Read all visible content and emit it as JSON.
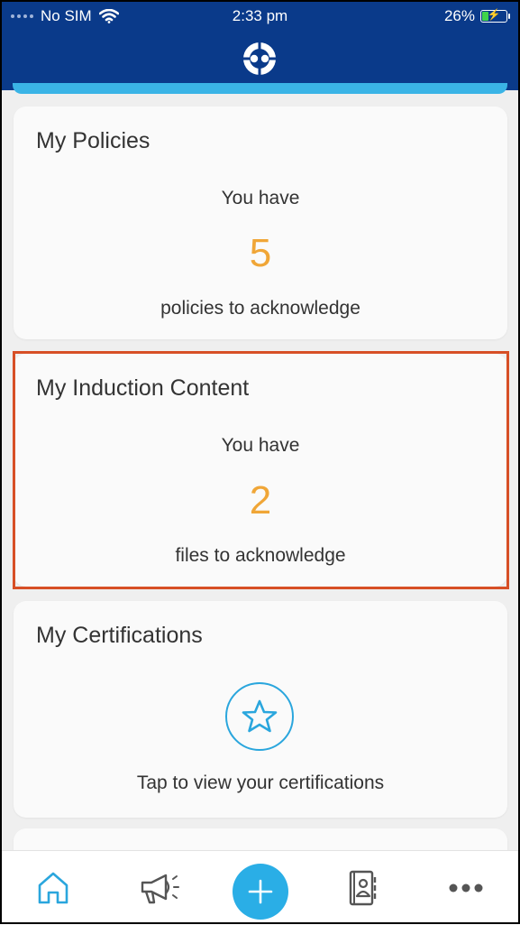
{
  "status_bar": {
    "carrier": "No SIM",
    "time": "2:33 pm",
    "battery": "26%",
    "battery_level": 0.26
  },
  "colors": {
    "header_bg": "#0a3a8a",
    "accent_blue": "#2aaee6",
    "count_orange": "#f0a637",
    "highlight_red": "#d74f26"
  },
  "cards": {
    "policies": {
      "title": "My Policies",
      "you_have": "You have",
      "count": "5",
      "subtitle": "policies to acknowledge"
    },
    "induction": {
      "title": "My Induction Content",
      "you_have": "You have",
      "count": "2",
      "subtitle": "files to acknowledge"
    },
    "certifications": {
      "title": "My Certifications",
      "icon": "star-icon",
      "subtitle": "Tap to view your certifications"
    }
  },
  "tab_bar": {
    "items": [
      {
        "name": "home",
        "icon": "home-icon"
      },
      {
        "name": "announcements",
        "icon": "megaphone-icon"
      },
      {
        "name": "add",
        "icon": "plus-icon"
      },
      {
        "name": "contacts",
        "icon": "address-book-icon"
      },
      {
        "name": "more",
        "icon": "more-icon"
      }
    ]
  }
}
